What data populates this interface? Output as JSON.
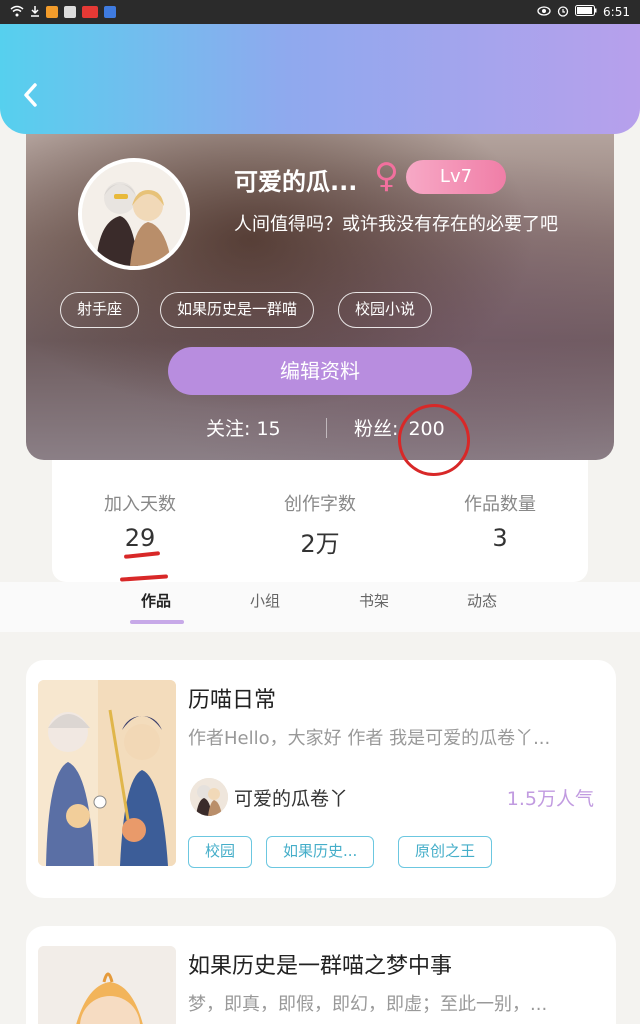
{
  "status_bar": {
    "time": "6:51"
  },
  "profile": {
    "nickname": "可爱的瓜...",
    "gender_icon": "♀",
    "level": "Lv7",
    "signature": "人间值得吗？或许我没有存在的必要了吧",
    "tags": [
      "射手座",
      "如果历史是一群喵",
      "校园小说"
    ],
    "edit_button": "编辑资料",
    "following_label": "关注:",
    "following_count": "15",
    "followers_label": "粉丝:",
    "followers_count": "200"
  },
  "stats": [
    {
      "label": "加入天数",
      "value": "29"
    },
    {
      "label": "创作字数",
      "value": "2万"
    },
    {
      "label": "作品数量",
      "value": "3"
    }
  ],
  "tabs": [
    "作品",
    "小组",
    "书架",
    "动态"
  ],
  "active_tab": "作品",
  "works": [
    {
      "title": "历喵日常",
      "description": "作者Hello，大家好 作者 我是可爱的瓜卷丫...",
      "author": "可爱的瓜卷丫",
      "popularity": "1.5万人气",
      "tags": [
        "校园",
        "如果历史...",
        "原创之王"
      ]
    },
    {
      "title": "如果历史是一群喵之梦中事",
      "description": "梦，即真，即假，即幻，即虚；至此一别，..."
    }
  ],
  "colors": {
    "header_gradient_start": "#56d0ee",
    "header_gradient_end": "#b7a0ec",
    "accent_purple": "#b88ddf",
    "annotation_red": "#d82828",
    "tag_cyan": "#45aec9"
  },
  "icons": {
    "back": "chevron-left-icon",
    "gender": "female-icon"
  }
}
